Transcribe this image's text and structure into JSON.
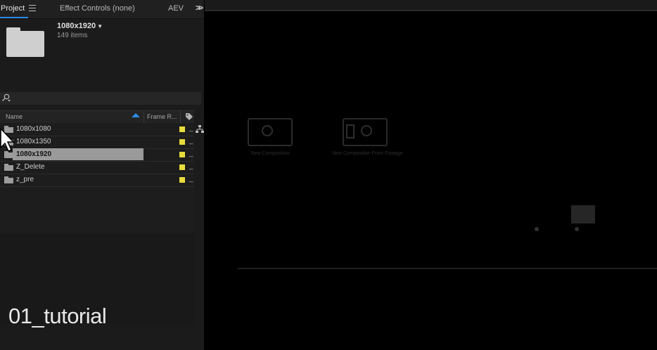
{
  "panel": {
    "tabs": [
      "Project",
      "Effect Controls (none)",
      "AEV"
    ],
    "selected": {
      "name": "1080x1920",
      "count": "149 items"
    },
    "search": {
      "placeholder": ""
    },
    "columns": {
      "name": "Name",
      "frame_rate": "Frame R..."
    },
    "items": [
      {
        "label": "1080x1080",
        "color": "#e7dc3c",
        "selected": false
      },
      {
        "label": "1080x1350",
        "color": "#e7dc3c",
        "selected": false
      },
      {
        "label": "1080x1920",
        "color": "#e7dc3c",
        "selected": true
      },
      {
        "label": "Z_Delete",
        "color": "#e7dc3c",
        "selected": false
      },
      {
        "label": "z_pre",
        "color": "#e7dc3c",
        "selected": false
      }
    ]
  },
  "viewer": {
    "new_composition": "New Composition",
    "new_composition_from_footage": "New Composition From Footage"
  },
  "watermark": "01_tutorial",
  "colors": {
    "accent": "#2d8ceb",
    "label_yellow": "#e7dc3c",
    "selection": "#9a9a9a"
  }
}
